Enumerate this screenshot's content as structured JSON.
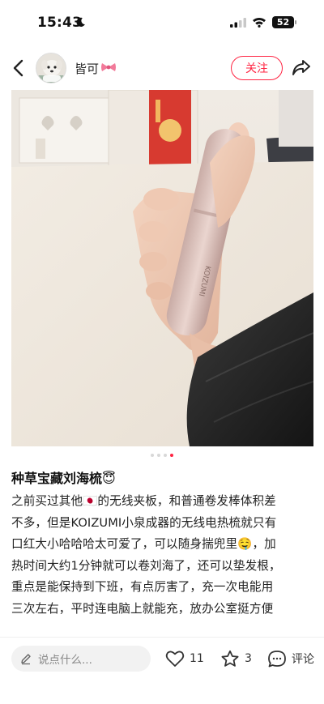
{
  "status_bar": {
    "time": "15:43",
    "battery": "52"
  },
  "header": {
    "author_name": "皆可",
    "follow_label": "关注"
  },
  "carousel": {
    "total": 4,
    "active_index": 3
  },
  "post": {
    "title": "种草宝藏刘海梳😇",
    "body_lines": [
      "之前买过其他🇯🇵的无线夹板，和普通卷发棒体积差",
      "不多，但是KOIZUMI小泉成器的无线电热梳就只有",
      "口红大小哈哈哈太可爱了，可以随身揣兜里🤤，加",
      "热时间大约1分钟就可以卷刘海了，还可以垫发根，",
      "重点是能保持到下班，有点厉害了，充一次电能用",
      "三次左右，平时连电脑上就能充，放办公室挺方便"
    ]
  },
  "product": {
    "brand_text": "KOIZUMI"
  },
  "bottom_bar": {
    "comment_placeholder": "说点什么...",
    "like_count": "11",
    "collect_count": "3",
    "comment_label": "评论"
  },
  "colors": {
    "accent": "#ff2442",
    "dot_inactive": "#d8d8d8"
  }
}
